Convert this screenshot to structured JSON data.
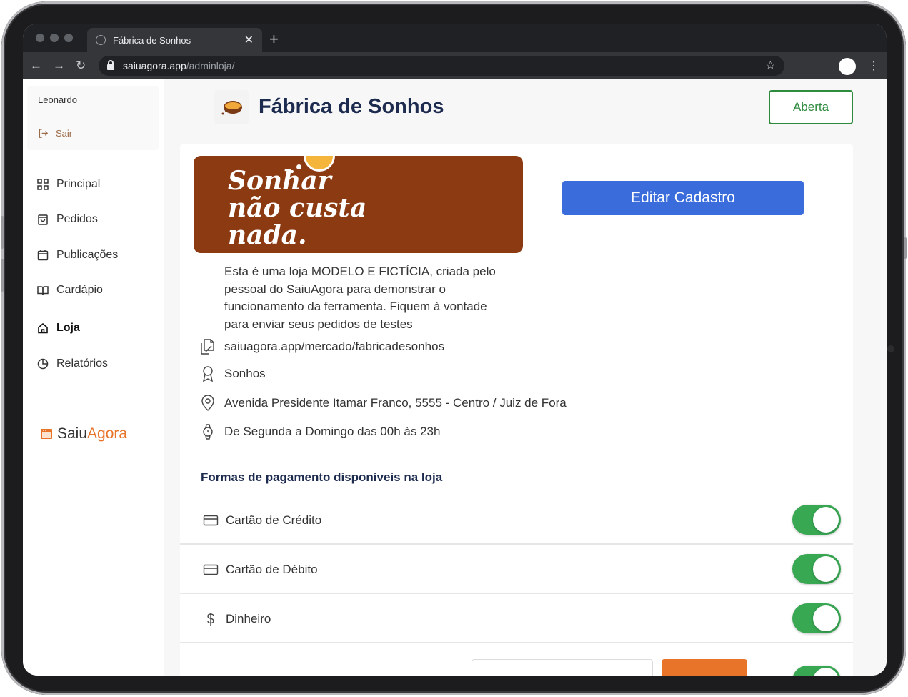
{
  "browser": {
    "tab_title": "Fábrica de Sonhos",
    "url_host": "saiuagora.app",
    "url_path": "/adminloja/"
  },
  "sidebar": {
    "user_name": "Leonardo",
    "logout_label": "Sair",
    "items": [
      {
        "label": "Principal",
        "icon": "grid-icon"
      },
      {
        "label": "Pedidos",
        "icon": "bag-icon"
      },
      {
        "label": "Publicações",
        "icon": "calendar-icon"
      },
      {
        "label": "Cardápio",
        "icon": "book-icon"
      },
      {
        "label": "Loja",
        "icon": "home-icon",
        "active": true
      },
      {
        "label": "Relatórios",
        "icon": "pie-chart-icon"
      }
    ],
    "brand_part1": "Saiu",
    "brand_part2": "Agora"
  },
  "store": {
    "name": "Fábrica de Sonhos",
    "status_label": "Aberta",
    "banner_line1": "Sonhar",
    "banner_line2": "não custa",
    "banner_line3": "nada.",
    "edit_button": "Editar Cadastro",
    "description": "Esta é uma loja MODELO E FICTÍCIA, criada pelo pessoal do SaiuAgora para demonstrar o funcionamento da ferramenta. Fiquem à vontade para enviar seus pedidos de testes",
    "link": "saiuagora.app/mercado/fabricadesonhos",
    "category": "Sonhos",
    "address": "Avenida Presidente Itamar Franco, 5555 - Centro / Juiz de Fora",
    "hours": "De Segunda a Domingo das 00h às 23h"
  },
  "payments": {
    "title": "Formas de pagamento disponíveis na loja",
    "methods": [
      {
        "label": "Cartão de Crédito",
        "enabled": true
      },
      {
        "label": "Cartão de Débito",
        "enabled": true
      },
      {
        "label": "Dinheiro",
        "enabled": true
      }
    ]
  },
  "colors": {
    "accent_blue": "#3a6ddb",
    "status_green": "#2e8b3e",
    "toggle_green": "#38a853",
    "brand_orange": "#e8742a",
    "banner_brown": "#8b3a12",
    "title_navy": "#1d2b4f"
  }
}
